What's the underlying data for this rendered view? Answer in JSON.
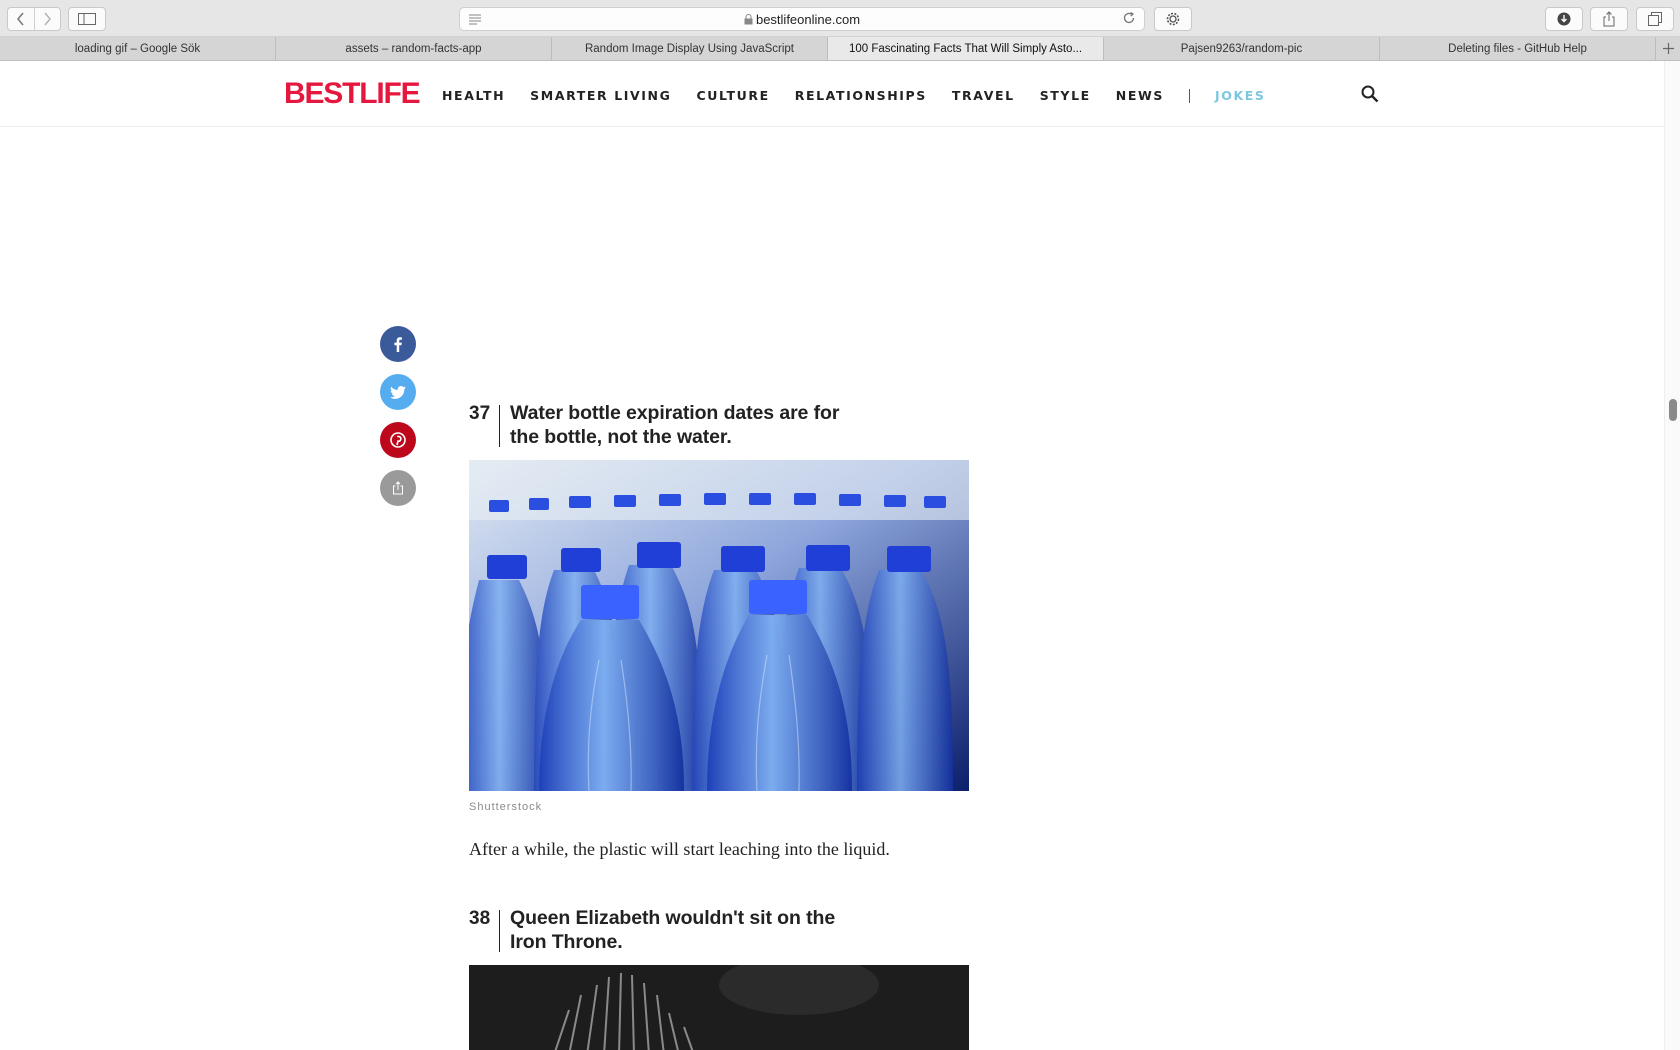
{
  "browser": {
    "url": "bestlifeonline.com",
    "tabs": [
      {
        "title": "loading gif – Google Sök",
        "active": false
      },
      {
        "title": "assets – random-facts-app",
        "active": false
      },
      {
        "title": "Random Image Display Using JavaScript",
        "active": false
      },
      {
        "title": "100 Fascinating Facts That Will Simply Asto...",
        "active": true
      },
      {
        "title": "Pajsen9263/random-pic",
        "active": false
      },
      {
        "title": "Deleting files - GitHub Help",
        "active": false
      }
    ],
    "icons": [
      "back-icon",
      "forward-icon",
      "sidebar-icon",
      "reader-icon",
      "lock-icon",
      "reload-icon",
      "gear-icon",
      "download-icon",
      "share-icon",
      "tabs-icon",
      "new-tab-icon"
    ]
  },
  "site": {
    "logo": {
      "best": "BEST",
      "life": "LIFE"
    },
    "nav": [
      "HEALTH",
      "SMARTER LIVING",
      "CULTURE",
      "RELATIONSHIPS",
      "TRAVEL",
      "STYLE",
      "NEWS",
      "JOKES"
    ],
    "brand_color": "#e5173f",
    "jokes_color": "#7cc7df"
  },
  "share": {
    "icons": [
      "facebook-icon",
      "twitter-icon",
      "pinterest-icon",
      "share-generic-icon"
    ],
    "colors": {
      "facebook": "#3b5a9a",
      "twitter": "#55acee",
      "pinterest": "#bd081c",
      "generic": "#9a9a9a"
    }
  },
  "article": {
    "facts": [
      {
        "number": "37",
        "title": "Water bottle expiration dates are for the bottle, not the water.",
        "image_credit": "Shutterstock",
        "body": "After a while, the plastic will start leaching into the liquid."
      },
      {
        "number": "38",
        "title": "Queen Elizabeth wouldn't sit on the Iron Throne."
      }
    ]
  }
}
